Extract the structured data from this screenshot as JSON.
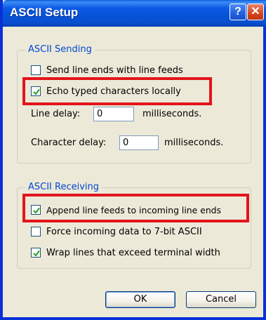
{
  "window": {
    "title": "ASCII Setup"
  },
  "titlebar": {
    "help_glyph": "?",
    "close_glyph": "✕"
  },
  "sending": {
    "title": "ASCII Sending",
    "send_line_ends": {
      "label": "Send line ends with line feeds",
      "checked": false
    },
    "echo_typed": {
      "label": "Echo typed characters locally",
      "checked": true
    },
    "line_delay": {
      "label": "Line delay:",
      "value": "0",
      "unit": "milliseconds."
    },
    "char_delay": {
      "label": "Character delay:",
      "value": "0",
      "unit": "milliseconds."
    }
  },
  "receiving": {
    "title": "ASCII Receiving",
    "append_line_feeds": {
      "label": "Append line feeds to incoming line ends",
      "checked": true
    },
    "force_7bit": {
      "label": "Force incoming data to 7-bit ASCII",
      "checked": false
    },
    "wrap_lines": {
      "label": "Wrap lines that exceed terminal width",
      "checked": true
    }
  },
  "buttons": {
    "ok": "OK",
    "cancel": "Cancel"
  },
  "colors": {
    "titlebar": "#0553d8",
    "group_title": "#0046d5",
    "highlight": "#e3141b",
    "face": "#ece9d8"
  }
}
